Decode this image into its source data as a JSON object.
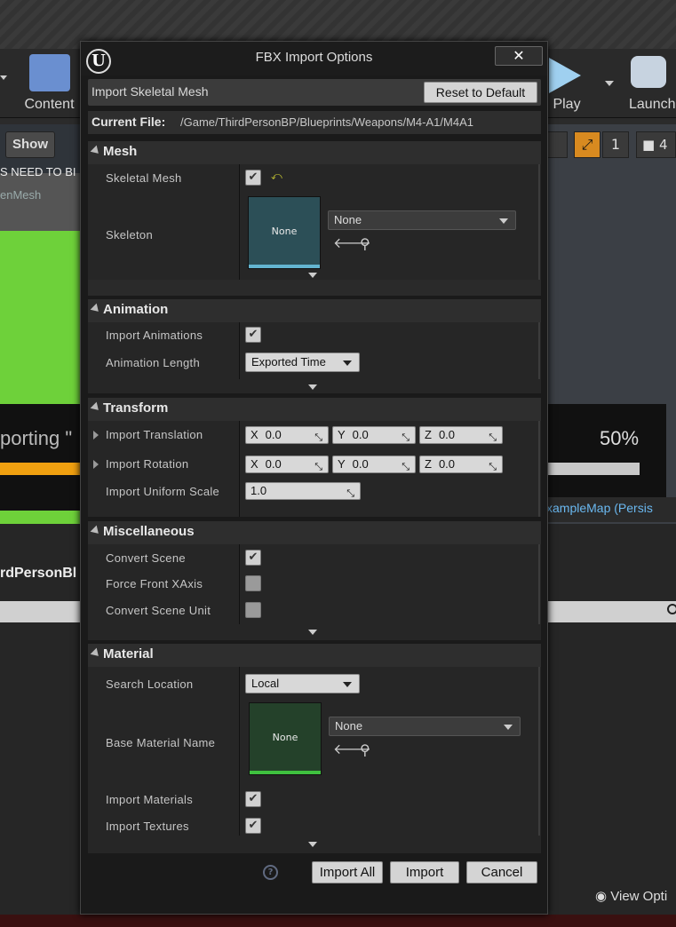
{
  "background": {
    "toolbar": {
      "content_label": "Content",
      "play_label": "Play",
      "launch_label": "Launch"
    },
    "viewport": {
      "show_label": "Show",
      "warning_text": "S NEED TO BI",
      "mesh_text": "enMesh",
      "importing_text": "porting \"",
      "progress_percent_label": "50%",
      "progress_value": 0.5,
      "map_text": "xampleMap (Persis",
      "snap_value": "1",
      "cam_value": "4"
    },
    "content_browser": {
      "path_text": "rdPersonBl",
      "view_options_label": "View Opti"
    }
  },
  "dialog": {
    "title": "FBX Import Options",
    "close_label": "✕",
    "logo_glyph": "U",
    "header": {
      "label": "Import Skeletal Mesh",
      "reset_label": "Reset to Default"
    },
    "current_file": {
      "label": "Current File:",
      "value": "/Game/ThirdPersonBP/Blueprints/Weapons/M4-A1/M4A1"
    },
    "sections": {
      "mesh": {
        "title": "Mesh",
        "skeletal_mesh_label": "Skeletal Mesh",
        "skeletal_mesh_checked": true,
        "reset_glyph": "⤺",
        "skeleton_label": "Skeleton",
        "skeleton_thumb": "None",
        "skeleton_combo": "None"
      },
      "animation": {
        "title": "Animation",
        "import_animations_label": "Import Animations",
        "import_animations_checked": true,
        "animation_length_label": "Animation Length",
        "animation_length_value": "Exported Time"
      },
      "transform": {
        "title": "Transform",
        "import_translation_label": "Import Translation",
        "translation": {
          "x_label": "X",
          "x": "0.0",
          "y_label": "Y",
          "y": "0.0",
          "z_label": "Z",
          "z": "0.0"
        },
        "import_rotation_label": "Import Rotation",
        "rotation": {
          "x_label": "X",
          "x": "0.0",
          "y_label": "Y",
          "y": "0.0",
          "z_label": "Z",
          "z": "0.0"
        },
        "uniform_scale_label": "Import Uniform Scale",
        "uniform_scale": "1.0"
      },
      "misc": {
        "title": "Miscellaneous",
        "convert_scene_label": "Convert Scene",
        "convert_scene_checked": true,
        "force_front_label": "Force Front XAxis",
        "force_front_checked": false,
        "convert_unit_label": "Convert Scene Unit",
        "convert_unit_checked": false
      },
      "material": {
        "title": "Material",
        "search_location_label": "Search Location",
        "search_location_value": "Local",
        "base_material_label": "Base Material Name",
        "base_material_thumb": "None",
        "base_material_combo": "None",
        "import_materials_label": "Import Materials",
        "import_materials_checked": true,
        "import_textures_label": "Import Textures",
        "import_textures_checked": true
      }
    },
    "footer": {
      "help_glyph": "?",
      "import_all_label": "Import All",
      "import_label": "Import",
      "cancel_label": "Cancel"
    }
  }
}
